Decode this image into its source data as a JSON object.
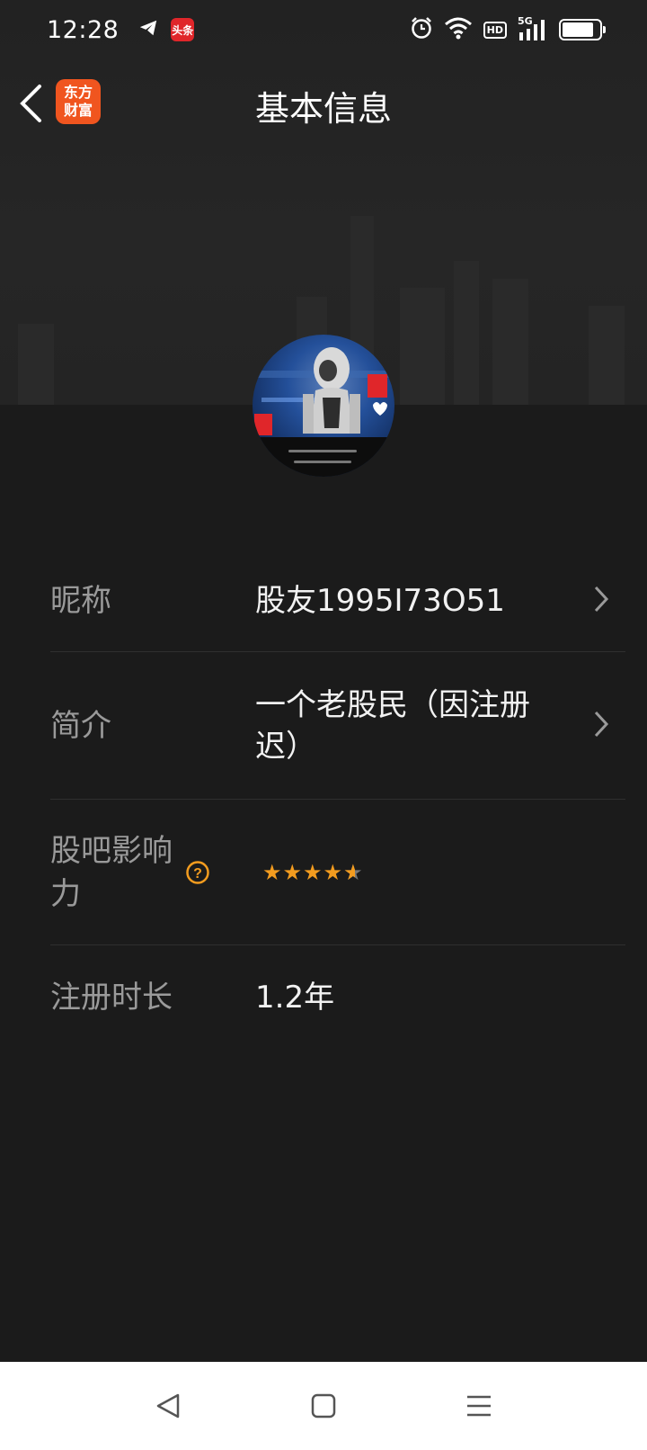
{
  "status_bar": {
    "time": "12:28",
    "icons": [
      "telegram-icon",
      "toutiao-app-icon",
      "alarm-icon",
      "wifi-icon",
      "hd-icon",
      "5g-signal-icon",
      "battery-icon"
    ],
    "toutiao_label": "头条",
    "hd_label": "HD",
    "network_label": "5G",
    "battery_level_percent": 86
  },
  "header": {
    "app_logo_line1": "东方",
    "app_logo_line2": "财富",
    "title": "基本信息",
    "accent_color": "#f0551f"
  },
  "profile": {
    "rows": [
      {
        "label": "昵称",
        "value": "股友1995I73O51"
      },
      {
        "label": "简介",
        "value": "一个老股民（因注册迟）"
      },
      {
        "label": "股吧影响力",
        "rating": 4.5,
        "rating_max": 5,
        "star_color": "#f39c1f"
      },
      {
        "label": "注册时长",
        "value": "1.2年"
      }
    ]
  },
  "bottom_nav": {
    "buttons": [
      "back-triangle-icon",
      "home-square-icon",
      "menu-lines-icon"
    ]
  }
}
